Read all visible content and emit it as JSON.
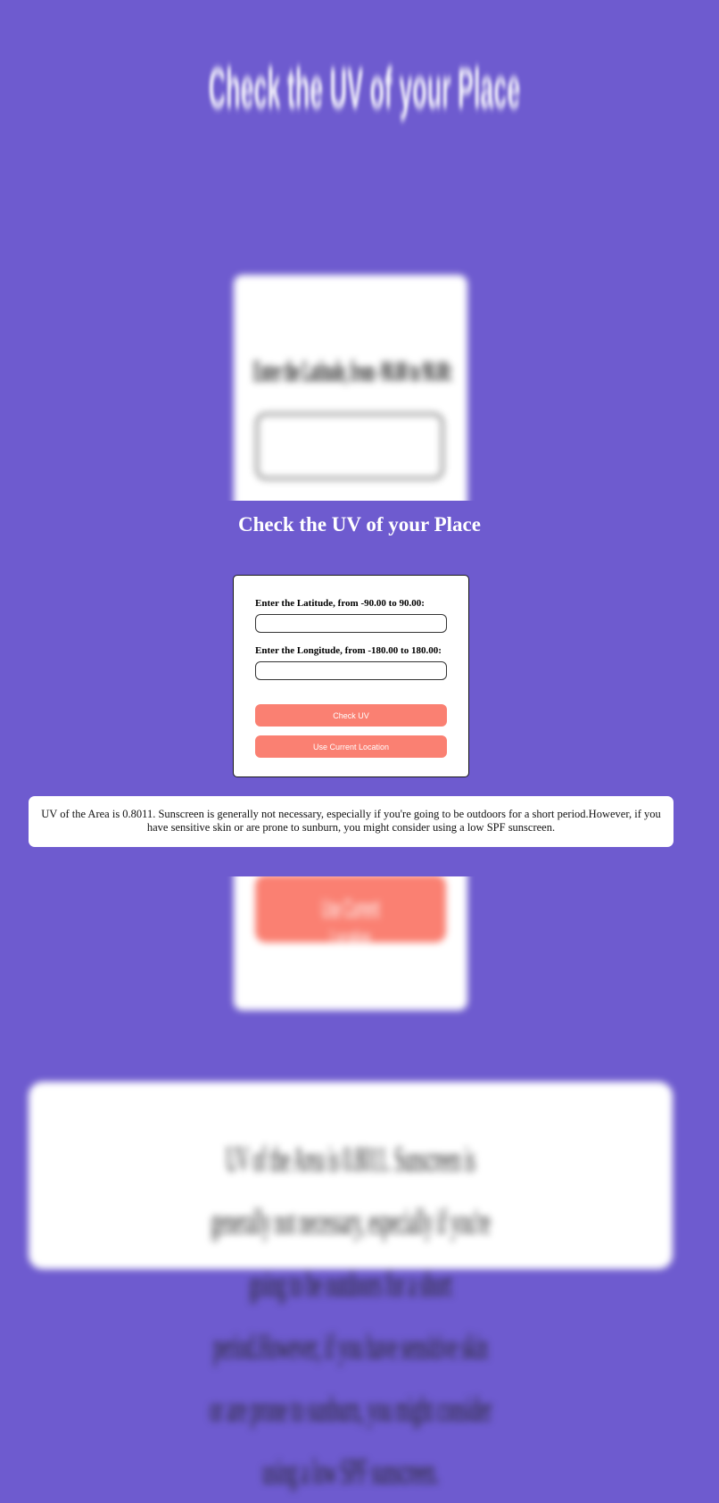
{
  "page": {
    "title": "Check the UV of your Place",
    "background_color": "#6e5bcf"
  },
  "form": {
    "latitude_label": "Enter the Latitude, from -90.00 to 90.00:",
    "latitude_value": "",
    "longitude_label": "Enter the Longitude, from -180.00 to 180.00:",
    "longitude_value": "",
    "check_button_label": "Check UV",
    "location_button_label": "Use Current Location",
    "button_color": "#fa8072"
  },
  "result": {
    "text": "UV of the Area is 0.8011. Sunscreen is generally not necessary, especially if you're going to be outdoors for a short period.However, if you have sensitive skin or are prone to sunburn, you might consider using a low SPF sunscreen."
  }
}
